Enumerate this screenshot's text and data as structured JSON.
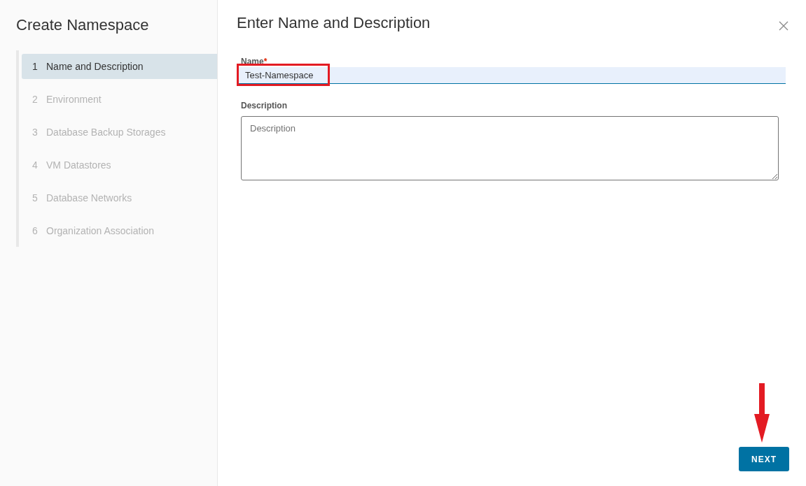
{
  "wizard": {
    "title": "Create Namespace"
  },
  "steps": [
    {
      "number": "1",
      "label": "Name and Description",
      "selected": true
    },
    {
      "number": "2",
      "label": "Environment",
      "selected": false
    },
    {
      "number": "3",
      "label": "Database Backup Storages",
      "selected": false
    },
    {
      "number": "4",
      "label": "VM Datastores",
      "selected": false
    },
    {
      "number": "5",
      "label": "Database Networks",
      "selected": false
    },
    {
      "number": "6",
      "label": "Organization Association",
      "selected": false
    }
  ],
  "page": {
    "title": "Enter Name and Description"
  },
  "form": {
    "name": {
      "label": "Name",
      "required_mark": "*",
      "value": "Test-Namespace",
      "highlighted": true
    },
    "description": {
      "label": "Description",
      "placeholder": "Description"
    }
  },
  "next_button": {
    "label": "NEXT",
    "pointed_at": true
  }
}
